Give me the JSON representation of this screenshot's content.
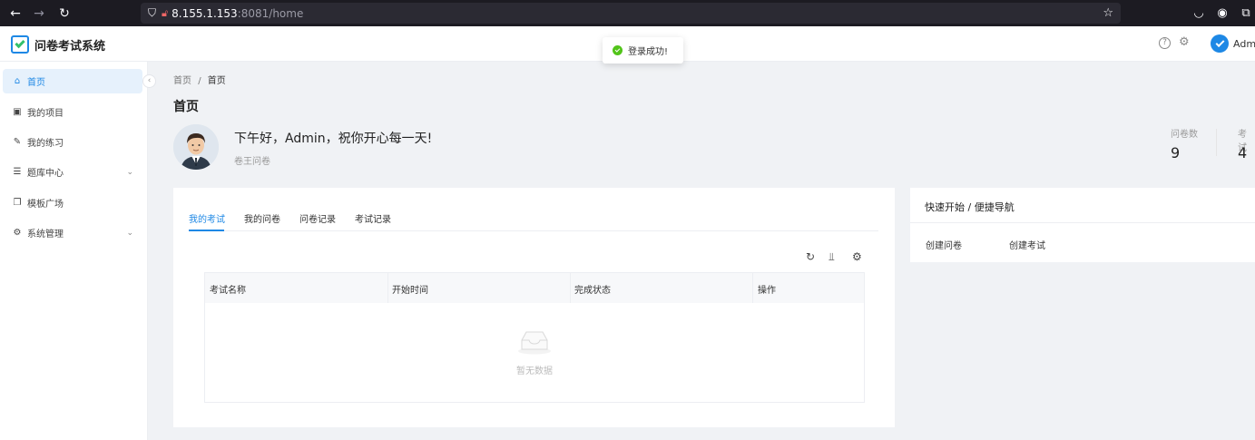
{
  "browser": {
    "nav_back": "←",
    "nav_forward": "→",
    "nav_reload": "↻",
    "url_host": "8.155.1.153",
    "url_path": ":8081/home",
    "icons": [
      "shield-icon",
      "lock-icon",
      "star-icon",
      "pocket-icon",
      "account-icon",
      "extensions-icon"
    ]
  },
  "header": {
    "app_title": "问卷考试系统",
    "help_glyph": "?",
    "user_name": "Admin"
  },
  "toast": {
    "message": "登录成功!",
    "status_color": "#52c41a"
  },
  "sidebar": {
    "collapse_glyph": "‹",
    "items": [
      {
        "label": "首页",
        "icon": "home-icon",
        "active": true
      },
      {
        "label": "我的项目",
        "icon": "project-icon"
      },
      {
        "label": "我的练习",
        "icon": "edit-icon"
      },
      {
        "label": "题库中心",
        "icon": "list-icon",
        "expandable": true
      },
      {
        "label": "模板广场",
        "icon": "copy-icon"
      },
      {
        "label": "系统管理",
        "icon": "gear-icon",
        "expandable": true
      }
    ]
  },
  "breadcrumb": {
    "root": "首页",
    "separator": "/",
    "current": "首页"
  },
  "page": {
    "title": "首页",
    "greeting": "下午好，Admin，祝你开心每一天!",
    "subtitle": "卷王问卷"
  },
  "stats": [
    {
      "label": "问卷数",
      "value": "9"
    },
    {
      "label": "考试",
      "value": "4"
    }
  ],
  "tabs": [
    {
      "label": "我的考试",
      "active": true
    },
    {
      "label": "我的问卷"
    },
    {
      "label": "问卷记录"
    },
    {
      "label": "考试记录"
    }
  ],
  "toolbar": {
    "icons": [
      "refresh-icon",
      "column-height-icon",
      "settings-icon"
    ]
  },
  "table": {
    "columns": [
      "考试名称",
      "开始时间",
      "完成状态",
      "操作"
    ],
    "rows": [],
    "empty_text": "暂无数据"
  },
  "quick_nav": {
    "title": "快速开始 / 便捷导航",
    "links": [
      "创建问卷",
      "创建考试"
    ]
  },
  "colors": {
    "accent": "#1e88e5",
    "success": "#52c41a"
  }
}
